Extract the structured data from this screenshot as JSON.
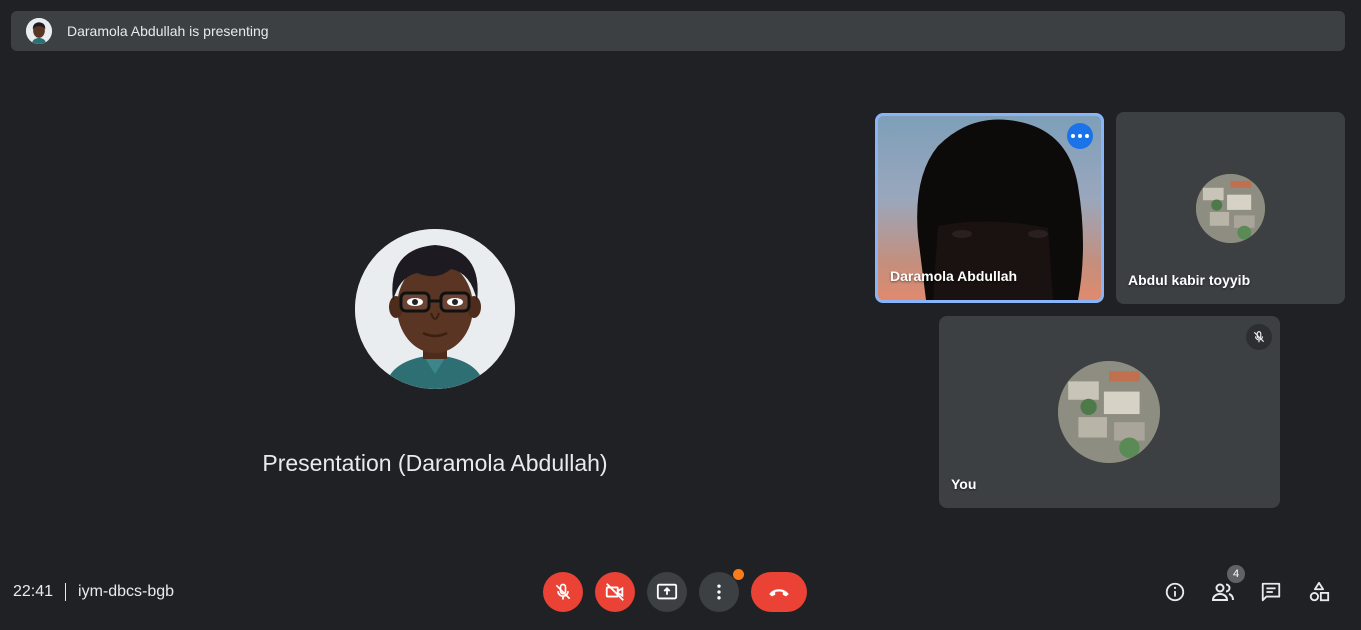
{
  "banner": {
    "presenting_text": "Daramola Abdullah is presenting"
  },
  "presentation": {
    "label": "Presentation (Daramola Abdullah)"
  },
  "tiles": {
    "video": {
      "name": "Daramola Abdullah"
    },
    "abdul": {
      "name": "Abdul kabir toyyib"
    },
    "you": {
      "name": "You"
    }
  },
  "meeting": {
    "time": "22:41",
    "code": "iym-dbcs-bgb"
  },
  "controls": {
    "mic": "mic-off-icon",
    "camera": "videocam-off-icon",
    "present": "present-to-all-icon",
    "more": "more-vertical-icon",
    "end": "call-end-icon"
  },
  "right": {
    "participants_count": "4"
  },
  "colors": {
    "background": "#202124",
    "surface": "#3c4043",
    "danger": "#ea4335",
    "accent": "#1a73e8",
    "highlight": "#8ab4f8",
    "notification": "#fa7b17"
  }
}
